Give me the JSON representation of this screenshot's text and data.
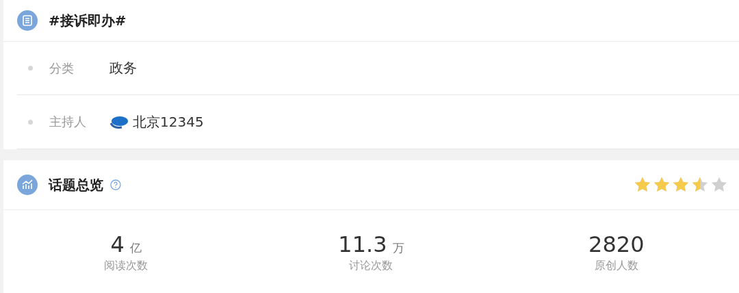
{
  "topic": {
    "title": "#接诉即办#"
  },
  "info_rows": [
    {
      "label": "分类",
      "value": "政务",
      "kind": "text"
    },
    {
      "label": "主持人",
      "value": "北京12345",
      "kind": "host"
    }
  ],
  "overview": {
    "title": "话题总览",
    "stars": 3.5,
    "stats": [
      {
        "number": "4",
        "unit": "亿",
        "label": "阅读次数"
      },
      {
        "number": "11.3",
        "unit": "万",
        "label": "讨论次数"
      },
      {
        "number": "2820",
        "label": "原创人数"
      }
    ]
  }
}
